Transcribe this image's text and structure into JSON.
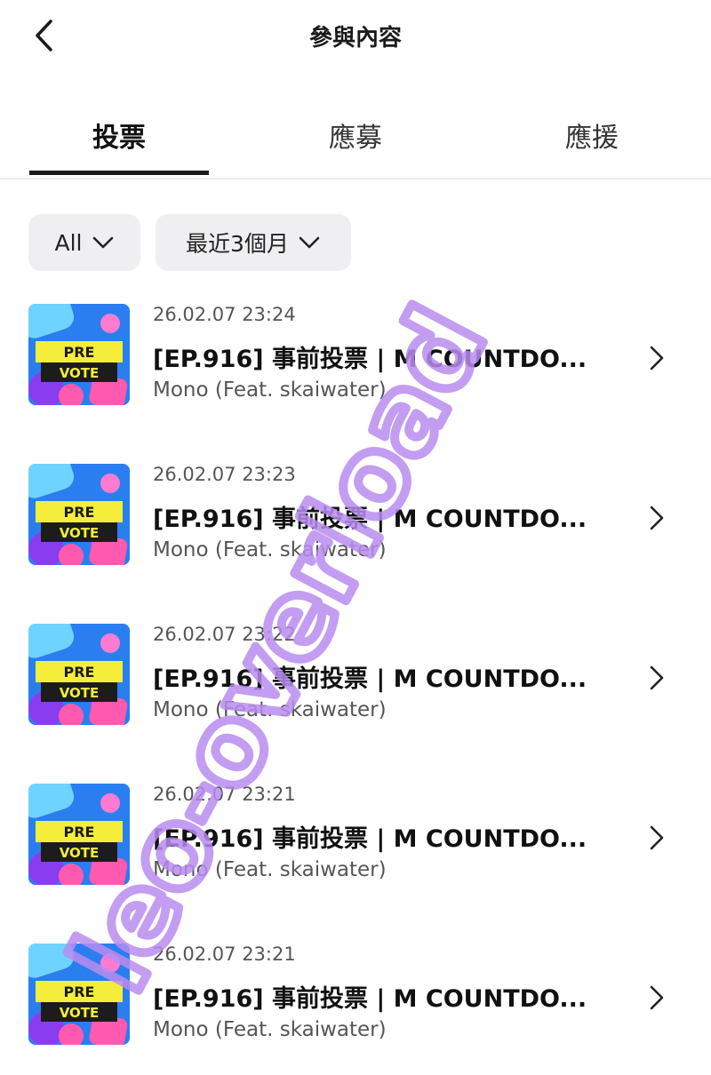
{
  "header": {
    "title": "參與內容"
  },
  "tabs": [
    {
      "label": "投票",
      "active": true
    },
    {
      "label": "應募",
      "active": false
    },
    {
      "label": "應援",
      "active": false
    }
  ],
  "filters": {
    "category": "All",
    "period": "最近3個月"
  },
  "thumbnail_text": {
    "line1": "PRE",
    "line2": "VOTE"
  },
  "items": [
    {
      "date": "26.02.07 23:24",
      "title": "[EP.916] 事前投票 | M COUNTDO...",
      "artist": "Mono (Feat. skaiwater)"
    },
    {
      "date": "26.02.07 23:23",
      "title": "[EP.916] 事前投票 | M COUNTDO...",
      "artist": "Mono (Feat. skaiwater)"
    },
    {
      "date": "26.02.07 23:22",
      "title": "[EP.916] 事前投票 | M COUNTDO...",
      "artist": "Mono (Feat. skaiwater)"
    },
    {
      "date": "26.02.07 23:21",
      "title": "[EP.916] 事前投票 | M COUNTDO...",
      "artist": "Mono (Feat. skaiwater)"
    },
    {
      "date": "26.02.07 23:21",
      "title": "[EP.916] 事前投票 | M COUNTDO...",
      "artist": "Mono (Feat. skaiwater)"
    }
  ],
  "watermark": {
    "text": "leo-overload",
    "color": "#b98cf0"
  },
  "colors": {
    "active_tab": "#1a1a1a",
    "chip_bg": "#efeff1",
    "thumb_blue": "#2a7ef0",
    "thumb_yellow": "#f4ee3a",
    "thumb_pink": "#ff5ab0"
  }
}
